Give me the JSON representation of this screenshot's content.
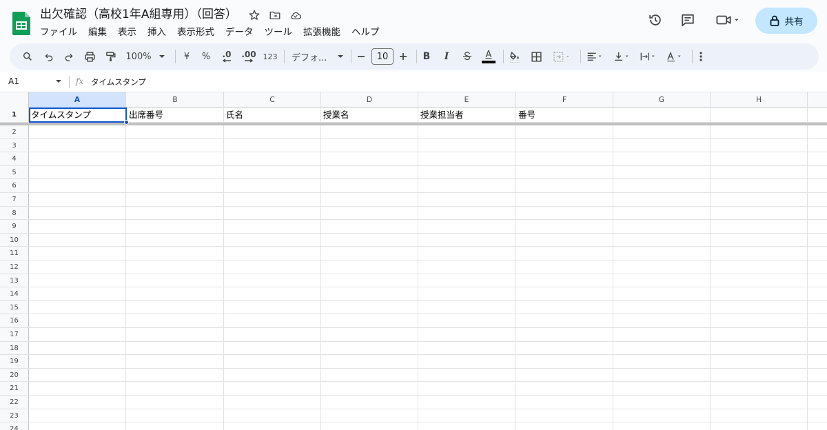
{
  "document": {
    "title": "出欠確認（高校1年A組専用）（回答）"
  },
  "menu": [
    "ファイル",
    "編集",
    "表示",
    "挿入",
    "表示形式",
    "データ",
    "ツール",
    "拡張機能",
    "ヘルプ"
  ],
  "header_actions": {
    "share_label": "共有"
  },
  "toolbar": {
    "zoom": "100%",
    "currency": "¥",
    "percent": "%",
    "decrease_decimal": ".0",
    "increase_decimal": ".00",
    "number_format": "123",
    "font": "デフォ...",
    "font_size": "10",
    "bold": "B",
    "italic": "I",
    "text_color_letter": "A",
    "text_color": "#000000"
  },
  "formula_bar": {
    "cell_ref": "A1",
    "fx": "fx",
    "value": "タイムスタンプ"
  },
  "sheet": {
    "columns": [
      "A",
      "B",
      "C",
      "D",
      "E",
      "F",
      "G",
      "H"
    ],
    "selected_column": "A",
    "selected_cell": "A1",
    "header_row": [
      "タイムスタンプ",
      "出席番号",
      "氏名",
      "授業名",
      "授業担当者",
      "番号",
      "",
      ""
    ],
    "row_numbers": [
      "1",
      "2",
      "3",
      "4",
      "5",
      "6",
      "7",
      "8",
      "9",
      "10",
      "11",
      "12",
      "13",
      "14",
      "15",
      "16",
      "17",
      "18",
      "19",
      "20",
      "21",
      "22",
      "23",
      "24"
    ]
  },
  "colors": {
    "accent": "#0b57d0",
    "share_bg": "#c2e7ff",
    "toolbar_bg": "#edf2fa",
    "sheets_green": "#0f9d58"
  }
}
